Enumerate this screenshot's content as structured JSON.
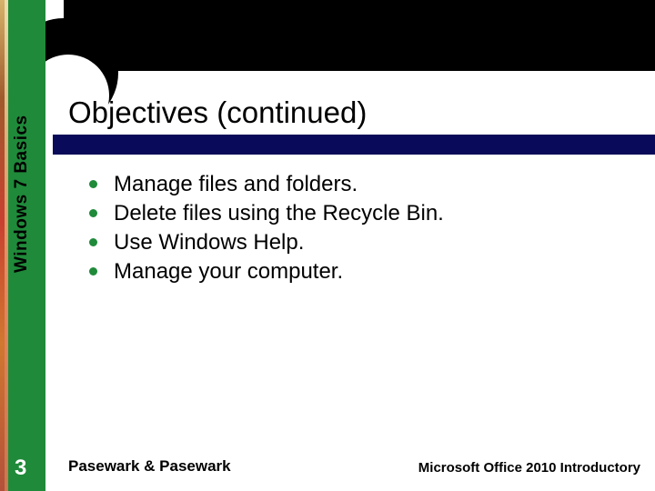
{
  "sidebar": {
    "label": "Windows 7 Basics",
    "page_number": "3"
  },
  "title": "Objectives (continued)",
  "bullets": [
    "Manage files and folders.",
    "Delete files using the Recycle Bin.",
    "Use Windows Help.",
    "Manage your computer."
  ],
  "footer": {
    "left": "Pasewark & Pasewark",
    "right": "Microsoft Office 2010 Introductory"
  }
}
